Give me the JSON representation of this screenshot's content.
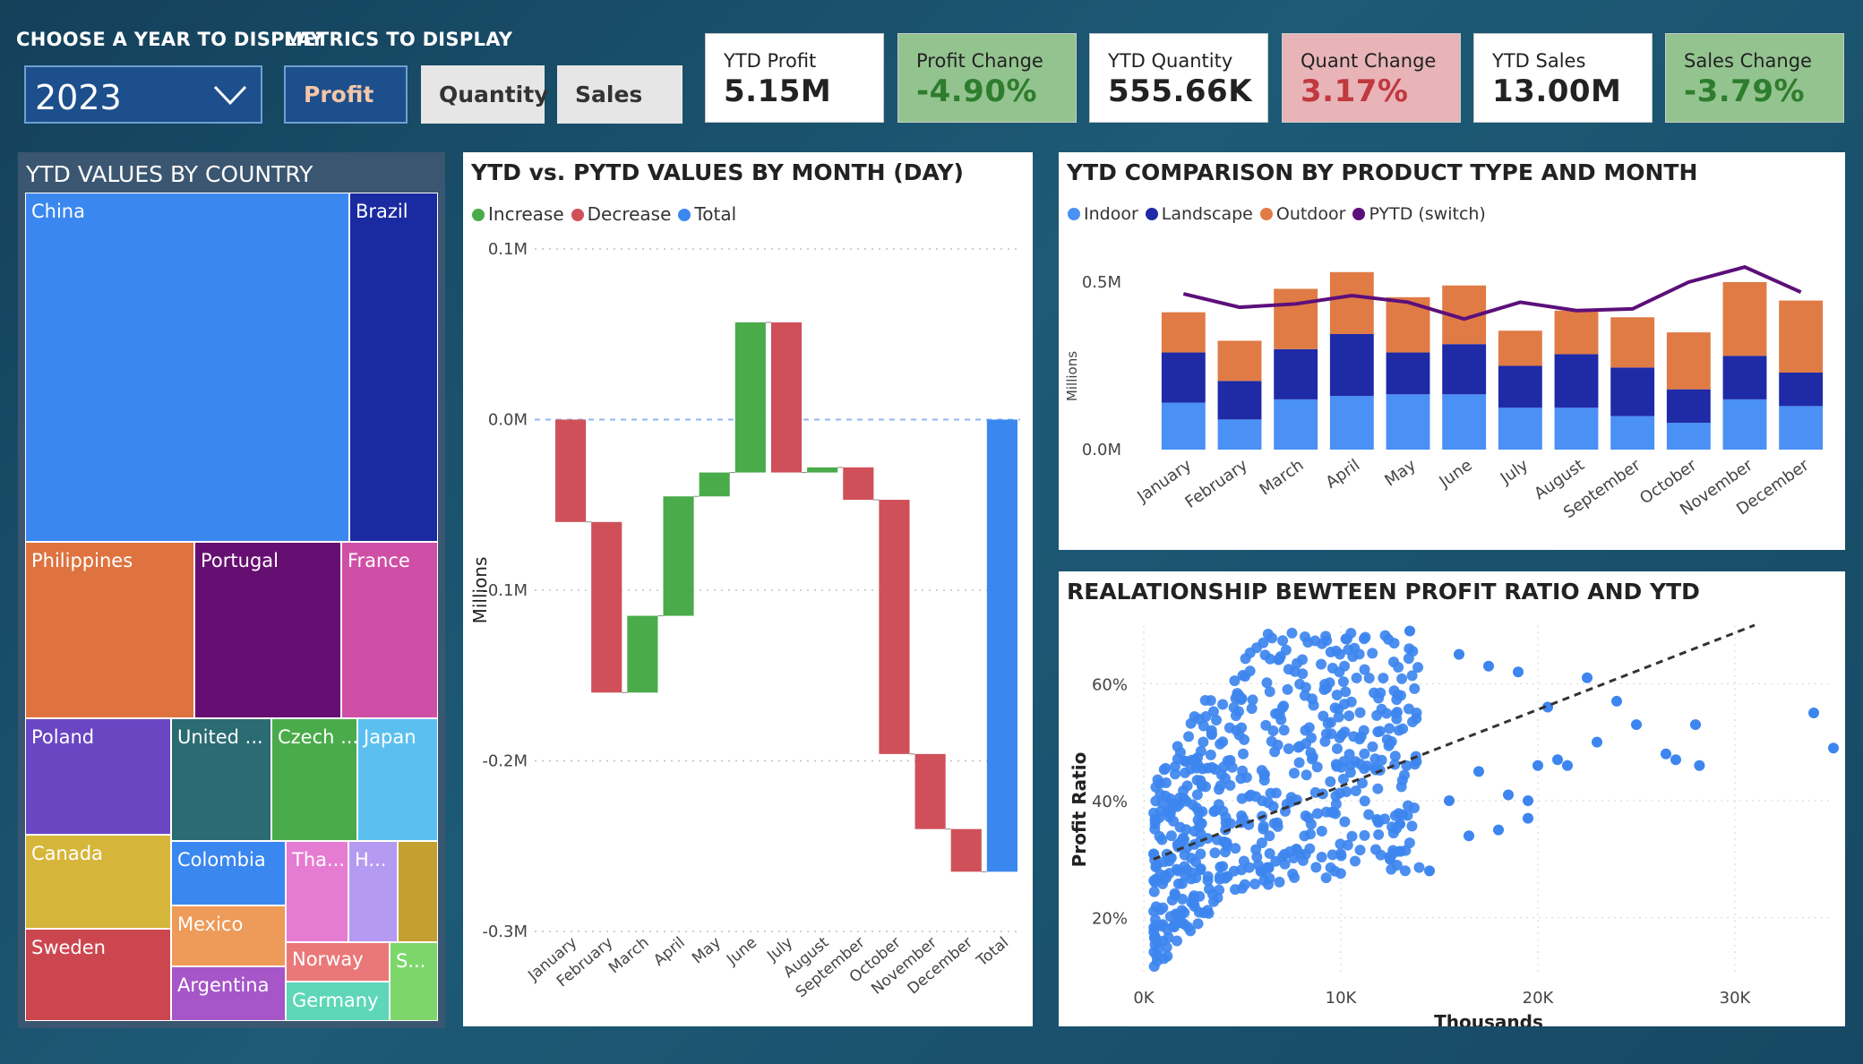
{
  "controls": {
    "year_label": "CHOOSE A YEAR TO DISPLAY",
    "year_value": "2023",
    "metrics_label": "METRICS TO DISPLAY",
    "metrics": [
      "Profit",
      "Quantity",
      "Sales"
    ],
    "selected_metric": "Profit"
  },
  "kpis": [
    {
      "label": "YTD Profit",
      "value": "5.15M",
      "tone": "neutral"
    },
    {
      "label": "Profit Change",
      "value": "-4.90%",
      "tone": "good"
    },
    {
      "label": "YTD Quantity",
      "value": "555.66K",
      "tone": "neutral"
    },
    {
      "label": "Quant Change",
      "value": "3.17%",
      "tone": "bad"
    },
    {
      "label": "YTD Sales",
      "value": "13.00M",
      "tone": "neutral"
    },
    {
      "label": "Sales Change",
      "value": "-3.79%",
      "tone": "good"
    }
  ],
  "colors": {
    "good_bg": "#93c48f",
    "good_fg": "#2e7d2e",
    "bad_bg": "#e8b4b8",
    "bad_fg": "#c0393f",
    "increase": "#4aab4a",
    "decrease": "#d0505a",
    "total": "#3b87f0",
    "indoor": "#4a90f5",
    "landscape": "#1f2aa6",
    "outdoor": "#e07b45",
    "pytd": "#5c0f7a",
    "scatter": "#3d85ef"
  },
  "treemap": {
    "title": "YTD VALUES BY COUNTRY",
    "tiles": [
      {
        "label": "China",
        "color": "#3b87f0"
      },
      {
        "label": "Brazil",
        "color": "#1a2aa0"
      },
      {
        "label": "Philippines",
        "color": "#de7340"
      },
      {
        "label": "Portugal",
        "color": "#660f72"
      },
      {
        "label": "France",
        "color": "#d04fa6"
      },
      {
        "label": "Poland",
        "color": "#6a46c2"
      },
      {
        "label": "United ...",
        "color": "#2b6b72"
      },
      {
        "label": "Czech ...",
        "color": "#4aab4a"
      },
      {
        "label": "Japan",
        "color": "#5bc0ef"
      },
      {
        "label": "Canada",
        "color": "#d6b63a"
      },
      {
        "label": "Colombia",
        "color": "#3b87f0"
      },
      {
        "label": "Tha...",
        "color": "#e57cd2"
      },
      {
        "label": "H...",
        "color": "#b49af0"
      },
      {
        "label": "",
        "color": "#c4a030"
      },
      {
        "label": "Sweden",
        "color": "#cc4650"
      },
      {
        "label": "Mexico",
        "color": "#ee9a58"
      },
      {
        "label": "Norway",
        "color": "#ea7878"
      },
      {
        "label": "S...",
        "color": "#7dd66a"
      },
      {
        "label": "Argentina",
        "color": "#a656c8"
      },
      {
        "label": "Germany",
        "color": "#5ed6b8"
      }
    ]
  },
  "chart_data": [
    {
      "type": "bar",
      "subtype": "waterfall",
      "title": "YTD vs. PYTD VALUES BY MONTH (DAY)",
      "ylabel": "Millions",
      "legend": [
        "Increase",
        "Decrease",
        "Total"
      ],
      "yticks": [
        "0.1M",
        "0.0M",
        "-0.1M",
        "-0.2M",
        "-0.3M"
      ],
      "ylim": [
        -0.3,
        0.1
      ],
      "categories": [
        "January",
        "February",
        "March",
        "April",
        "May",
        "June",
        "July",
        "August",
        "September",
        "October",
        "November",
        "December",
        "Total"
      ],
      "deltas": [
        -0.06,
        -0.1,
        0.045,
        0.07,
        0.014,
        0.088,
        -0.088,
        0.003,
        -0.019,
        -0.149,
        -0.044,
        -0.025,
        -0.266
      ]
    },
    {
      "type": "bar",
      "subtype": "stacked-with-line",
      "title": "YTD COMPARISON BY PRODUCT TYPE AND MONTH",
      "ylabel": "Millions",
      "yticks": [
        "0.5M",
        "0.0M"
      ],
      "ylim": [
        0,
        0.5
      ],
      "legend_position": "top-left",
      "categories": [
        "January",
        "February",
        "March",
        "April",
        "May",
        "June",
        "July",
        "August",
        "September",
        "October",
        "November",
        "December"
      ],
      "series": [
        {
          "name": "Indoor",
          "values": [
            0.14,
            0.09,
            0.15,
            0.16,
            0.165,
            0.165,
            0.125,
            0.125,
            0.1,
            0.08,
            0.15,
            0.13
          ]
        },
        {
          "name": "Landscape",
          "values": [
            0.15,
            0.115,
            0.15,
            0.185,
            0.125,
            0.15,
            0.125,
            0.16,
            0.145,
            0.1,
            0.13,
            0.1
          ]
        },
        {
          "name": "Outdoor",
          "values": [
            0.12,
            0.12,
            0.18,
            0.185,
            0.165,
            0.175,
            0.105,
            0.13,
            0.15,
            0.17,
            0.22,
            0.215
          ]
        },
        {
          "name": "PYTD (switch)",
          "type": "line",
          "values": [
            0.465,
            0.425,
            0.435,
            0.46,
            0.44,
            0.39,
            0.44,
            0.415,
            0.42,
            0.5,
            0.545,
            0.47
          ]
        }
      ]
    },
    {
      "type": "scatter",
      "title": "REALATIONSHIP BEWTEEN PROFIT RATIO AND YTD",
      "xlabel": "Thousands",
      "ylabel": "Profit Ratio",
      "xticks": [
        "0K",
        "10K",
        "20K",
        "30K"
      ],
      "yticks": [
        "20%",
        "40%",
        "60%"
      ],
      "xlim": [
        0,
        35
      ],
      "ylim": [
        10,
        70
      ],
      "trendline": {
        "x": [
          0.5,
          31
        ],
        "y": [
          30,
          70
        ]
      },
      "outliers": [
        {
          "x": 22.5,
          "y": 61
        },
        {
          "x": 24,
          "y": 57
        },
        {
          "x": 25,
          "y": 53
        },
        {
          "x": 26.5,
          "y": 48
        },
        {
          "x": 27,
          "y": 47
        },
        {
          "x": 28,
          "y": 53
        },
        {
          "x": 28.2,
          "y": 46
        },
        {
          "x": 23,
          "y": 50
        },
        {
          "x": 21,
          "y": 47
        },
        {
          "x": 20,
          "y": 46
        },
        {
          "x": 21.5,
          "y": 46
        },
        {
          "x": 19.5,
          "y": 40
        },
        {
          "x": 18.5,
          "y": 41
        },
        {
          "x": 19.5,
          "y": 37
        },
        {
          "x": 16.5,
          "y": 34
        },
        {
          "x": 18,
          "y": 35
        },
        {
          "x": 14.5,
          "y": 28
        },
        {
          "x": 12.5,
          "y": 30
        },
        {
          "x": 34,
          "y": 55
        },
        {
          "x": 35,
          "y": 49
        },
        {
          "x": 16,
          "y": 65
        },
        {
          "x": 17.5,
          "y": 63
        },
        {
          "x": 19,
          "y": 62
        },
        {
          "x": 13.5,
          "y": 69
        },
        {
          "x": 20.5,
          "y": 56
        },
        {
          "x": 17,
          "y": 45
        },
        {
          "x": 15.5,
          "y": 40
        },
        {
          "x": 13,
          "y": 36
        }
      ],
      "cluster": {
        "count": 560,
        "x_range": [
          0.5,
          14
        ],
        "y_range": [
          11,
          69
        ],
        "seed": 7
      }
    }
  ]
}
